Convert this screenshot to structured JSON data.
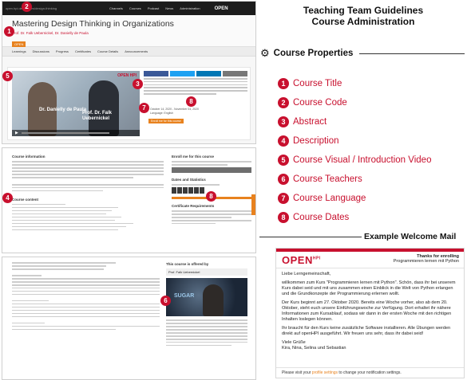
{
  "page": {
    "title_line1": "Teaching Team Guidelines",
    "title_line2": "Course Administration"
  },
  "properties": {
    "heading": "Course Properties",
    "items": [
      {
        "num": "1",
        "label": "Course Title"
      },
      {
        "num": "2",
        "label": "Course Code"
      },
      {
        "num": "3",
        "label": "Abstract"
      },
      {
        "num": "4",
        "label": "Description"
      },
      {
        "num": "5",
        "label": "Course Visual / Introduction Video"
      },
      {
        "num": "6",
        "label": "Course Teachers"
      },
      {
        "num": "7",
        "label": "Course Language"
      },
      {
        "num": "8",
        "label": "Course Dates"
      }
    ]
  },
  "mail_section": {
    "heading": "Example Welcome Mail"
  },
  "mail": {
    "logo": "OPEN",
    "logo_sup": "HPI",
    "thanks_line1": "Thanks for enrolling",
    "thanks_line2": "Programmieren lernen mit Python",
    "greeting": "Liebe Lerngemeinschaft,",
    "para1": "willkommen zum Kurs \"Programmieren lernen mit Python\". Schön, dass ihr bei unserem Kurs dabei seid und mit uns zusammen einen Einblick in die Welt von Python erlangen und die Grundkonzepte der Programmierung erlernen wollt.",
    "para2": "Der Kurs beginnt am 27. Oktober 2020. Bereits eine Woche vorher, also ab dem 20. Oktober, steht euch unsere Einführungswoche zur Verfügung. Dort erhaltet ihr nähere Informationen zum Kursablauf, sodass wir dann in der ersten Woche mit den richtigen Inhalten loslegen können.",
    "para3": "Ihr braucht für den Kurs keine zusätzliche Software installieren. Alle Übungen werden direkt auf openHPI ausgeführt. Wir freuen uns sehr, dass ihr dabei seid!",
    "closing1": "Viele Grüße",
    "closing2": "Kira, Nina, Selina und Sebastian",
    "footer_pre": "Please visit your ",
    "footer_link": "profile settings",
    "footer_post": " to change your notification settings."
  },
  "shot1": {
    "url": "open.hpi.de/courses/design-thinking",
    "logo": "OPEN",
    "logo_sup": "HPI",
    "nav": [
      "Channels",
      "Courses",
      "Podcast",
      "News",
      "Administration"
    ],
    "course_title": "Mastering Design Thinking in Organizations",
    "teachers": "Prof. Dr. Falk Uebernickel, Dr. Danielly de Paula",
    "code": "OPEN",
    "tabs": [
      "Learnings",
      "Discussions",
      "Progress",
      "Certificates",
      "Course Details",
      "Announcements"
    ],
    "video_label1": "Dr. Danielly de Paula",
    "video_label2": "Prof. Dr. Falk Uebernickel",
    "video_logo": "OPEN HPI",
    "dates": "October 14, 2020 - November 04, 2020",
    "language": "Language: English",
    "enroll": "Enroll me for this course"
  },
  "shot2": {
    "section": "Course information",
    "right_title": "Enroll me for this course",
    "stats_title": "Dates and Statistics",
    "cert_title": "Certificate Requirements",
    "desc_label": "Course content"
  },
  "shot3": {
    "offered_by": "This course is offered by",
    "teacher": "Prof. Falk Uebernickel",
    "photo_text": "SUGAR"
  }
}
